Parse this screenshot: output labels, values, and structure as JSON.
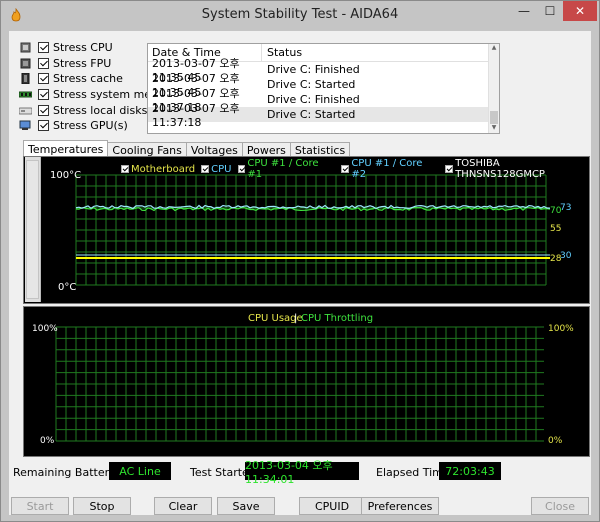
{
  "window": {
    "title": "System Stability Test - AIDA64",
    "minimize": "—",
    "maximize": "☐",
    "close": "✕"
  },
  "stress": [
    {
      "label": "Stress CPU",
      "icon": "cpu-icon"
    },
    {
      "label": "Stress FPU",
      "icon": "fpu-icon"
    },
    {
      "label": "Stress cache",
      "icon": "cache-icon"
    },
    {
      "label": "Stress system memory",
      "icon": "memory-icon"
    },
    {
      "label": "Stress local disks",
      "icon": "disk-icon"
    },
    {
      "label": "Stress GPU(s)",
      "icon": "gpu-icon"
    }
  ],
  "log": {
    "headers": [
      "Date & Time",
      "Status"
    ],
    "rows": [
      [
        "2013-03-07 오후 11:35:45",
        "Drive C: Finished"
      ],
      [
        "2013-03-07 오후 11:35:45",
        "Drive C: Started"
      ],
      [
        "2013-03-07 오후 11:37:18",
        "Drive C: Finished"
      ],
      [
        "2013-03-07 오후 11:37:18",
        "Drive C: Started"
      ]
    ]
  },
  "tabs": [
    "Temperatures",
    "Cooling Fans",
    "Voltages",
    "Powers",
    "Statistics"
  ],
  "temp_chart": {
    "legend": [
      {
        "label": "Motherboard",
        "color": "#e5e54a"
      },
      {
        "label": "CPU",
        "color": "#62d0ff"
      },
      {
        "label": "CPU #1 / Core #1",
        "color": "#3ee23e"
      },
      {
        "label": "CPU #1 / Core #2",
        "color": "#62d0ff"
      },
      {
        "label": "TOSHIBA THNSNS128GMCP",
        "color": "#ffffff"
      }
    ],
    "ymax_label": "100°C",
    "ymin_label": "0°C",
    "right_labels": [
      {
        "text": "70",
        "color": "#3ee23e"
      },
      {
        "text": "73",
        "color": "#62d0ff"
      },
      {
        "text": "55",
        "color": "#e5e54a"
      },
      {
        "text": "28",
        "color": "#e5e54a"
      },
      {
        "text": "30",
        "color": "#62d0ff"
      }
    ]
  },
  "usage_chart": {
    "legend_usage": "CPU Usage",
    "legend_sep": "|",
    "legend_throttle": "CPU Throttling",
    "left_top": "100%",
    "left_bottom": "0%",
    "right_top": "100%",
    "right_bottom": "0%"
  },
  "info": {
    "battery_label": "Remaining Battery:",
    "battery_value": "AC Line",
    "started_label": "Test Started:",
    "started_value": "2013-03-04 오후 11:34:01",
    "elapsed_label": "Elapsed Time:",
    "elapsed_value": "72:03:43"
  },
  "buttons": {
    "start": "Start",
    "stop": "Stop",
    "clear": "Clear",
    "save": "Save",
    "cpuid": "CPUID",
    "preferences": "Preferences",
    "close": "Close"
  }
}
